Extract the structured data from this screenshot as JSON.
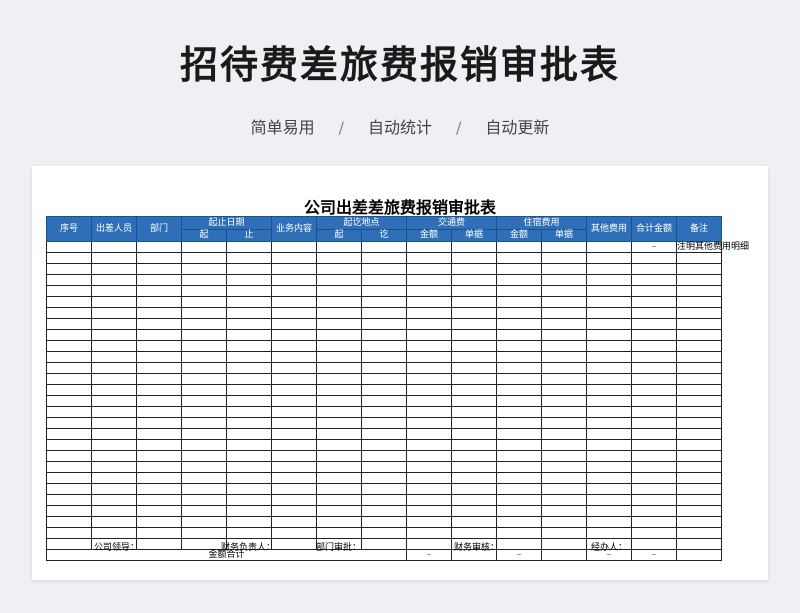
{
  "page": {
    "title": "招待费差旅费报销审批表",
    "tags": [
      "简单易用",
      "自动统计",
      "自动更新"
    ],
    "tag_separator": "/"
  },
  "sheet": {
    "title": "公司出差差旅费报销审批表",
    "headers": {
      "seq": "序号",
      "traveler": "出差人员",
      "dept": "部门",
      "date_range": "起止日期",
      "date_start": "起",
      "date_end": "止",
      "business": "业务内容",
      "place_range": "起讫地点",
      "place_start": "起",
      "place_end": "讫",
      "transport": "交通费",
      "transport_amount": "金额",
      "transport_receipts": "单据",
      "lodging": "住宿费用",
      "lodging_amount": "金额",
      "lodging_receipts": "单据",
      "other": "其他费用",
      "total": "合计金额",
      "remark": "备注"
    },
    "first_row": {
      "total": "–",
      "remark": "注明其他费用明细"
    },
    "empty_rows": 27,
    "footer_row": {
      "label": "金额合计",
      "transport_amount": "–",
      "lodging_amount": "–",
      "other": "–",
      "total": "–"
    },
    "signatures": {
      "leader": "公司领导：",
      "finance_head": "财务负责人：",
      "dept_approval": "部门审批：",
      "finance_review": "财务审核：",
      "handler": "经办人："
    }
  }
}
